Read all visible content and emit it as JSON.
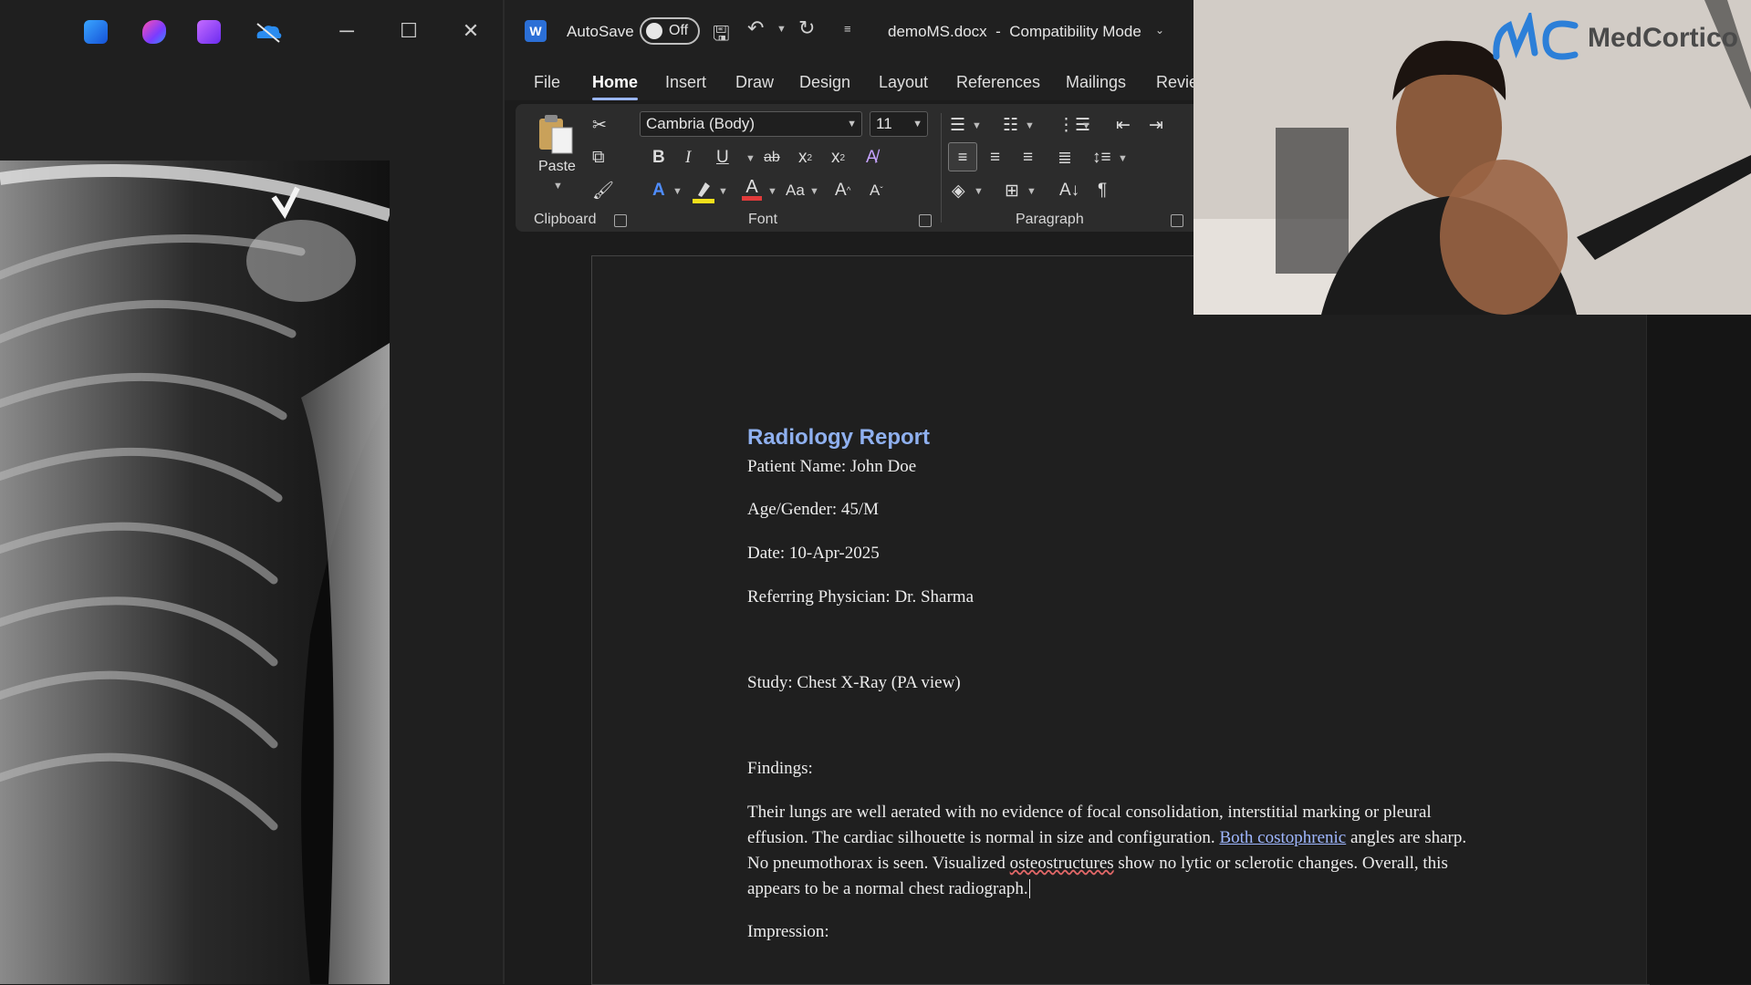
{
  "word": {
    "autosave_label": "AutoSave",
    "autosave_state": "Off",
    "doc_title": "demoMS.docx  -  Compatibility Mode",
    "tabs": [
      "File",
      "Home",
      "Insert",
      "Draw",
      "Design",
      "Layout",
      "References",
      "Mailings",
      "Revie"
    ],
    "active_tab": "Home",
    "ribbon": {
      "paste_label": "Paste",
      "clipboard_group": "Clipboard",
      "font_group": "Font",
      "paragraph_group": "Paragraph",
      "font_name": "Cambria (Body)",
      "font_size": "11",
      "bold": "B",
      "italic": "I",
      "underline": "U",
      "strike": "ab",
      "change_case": "Aa",
      "pilcrow": "¶"
    }
  },
  "document": {
    "title": "Radiology Report",
    "lines": [
      "Patient Name: John Doe",
      "Age/Gender: 45/M",
      "Date: 10-Apr-2025",
      "Referring Physician: Dr. Sharma",
      "Study: Chest X-Ray (PA view)",
      "Findings:"
    ],
    "findings": {
      "part1": "Their lungs are well aerated with no evidence of focal consolidation, interstitial marking or pleural effusion. The cardiac silhouette is normal in size and configuration. ",
      "link1": "Both costophrenic",
      "part2": " angles are sharp. No pneumothorax is seen. Visualized ",
      "misspelled": "osteostructures",
      "part3": " show no lytic or sclerotic changes. Overall, this appears to be a normal chest radiograph."
    },
    "impression": "Impression:"
  },
  "webcam": {
    "logo_text": "MedCortico"
  },
  "colors": {
    "accent": "#9ab6ff",
    "title_blue": "#8fb0ef",
    "font_color_red": "#e23b3b",
    "highlight_yellow": "#f3e01b"
  }
}
